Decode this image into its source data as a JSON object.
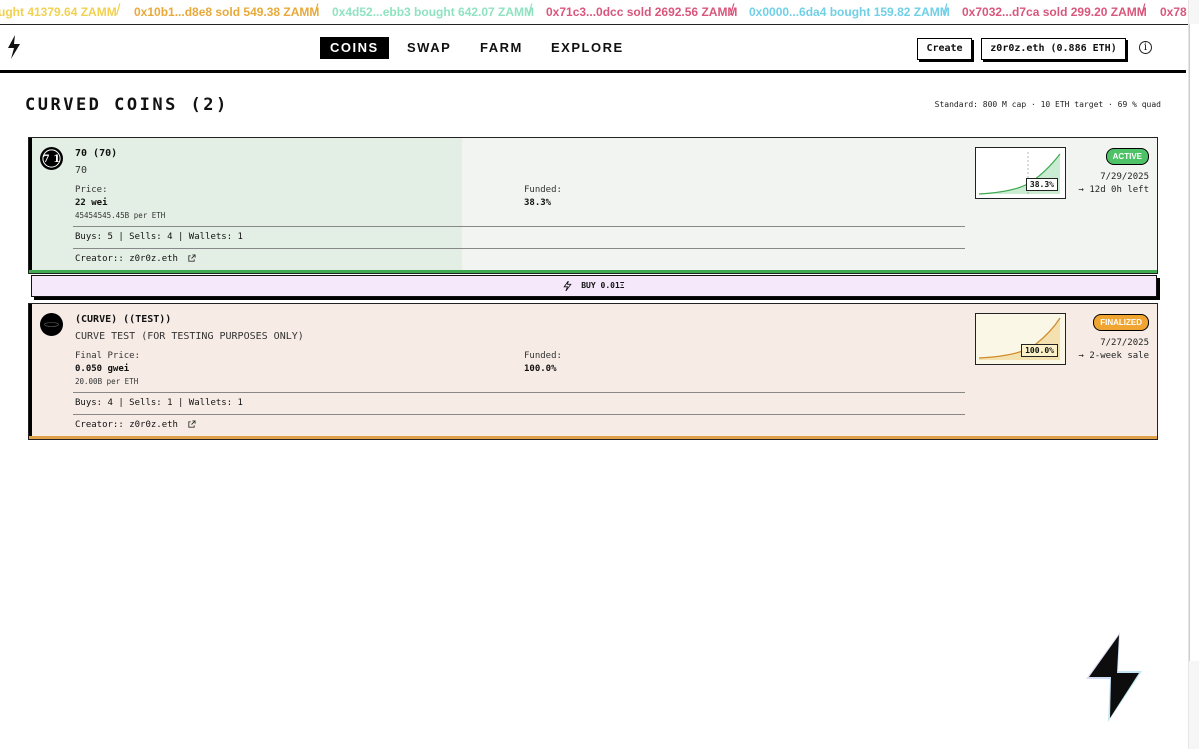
{
  "ticker": [
    {
      "text": "ught 41379.64 ZAMM",
      "color": "#f2d14e"
    },
    {
      "text": "0x10b1...d8e8 sold 549.38 ZAMM",
      "color": "#e8a93a"
    },
    {
      "text": "0x4d52...ebb3 bought 642.07 ZAMM",
      "color": "#8fe3c0"
    },
    {
      "text": "0x71c3...0dcc sold 2692.56 ZAMM",
      "color": "#d9567c"
    },
    {
      "text": "0x0000...6da4 bought 159.82 ZAMM",
      "color": "#6fd0e6"
    },
    {
      "text": "0x7032...d7ca sold 299.20 ZAMM",
      "color": "#d9567c"
    },
    {
      "text": "0x78",
      "color": "#d9567c"
    }
  ],
  "nav": {
    "coins": "COINS",
    "swap": "SWAP",
    "farm": "FARM",
    "explore": "EXPLORE"
  },
  "header": {
    "create_label": "Create",
    "account_label": "z0r0z.eth (0.886 ETH)",
    "info_glyph": "i"
  },
  "page": {
    "title": "CURVED COINS (2)",
    "standard_note": "Standard: 800 M cap · 10 ETH target · 69 % quad"
  },
  "coins": [
    {
      "name": "70 (70)",
      "description": "70",
      "avatar_text": "7 1",
      "price_label": "Price:",
      "price_value": "22 wei",
      "price_per_eth": "45454545.45B per ETH",
      "funded_label": "Funded:",
      "funded_value": "38.3%",
      "funded_fraction": 0.383,
      "stats": "Buys: 5 | Sells: 4 | Wallets: 1",
      "creator_label": "Creator::",
      "creator_value": "z0r0z.eth",
      "chart_pct": "38.3%",
      "status": "ACTIVE",
      "status_color": "#4ec267",
      "date": "7/29/2025",
      "eta": "→ 12d 0h left",
      "fill_color": "#e3efe4",
      "bg_color": "#f1f4f1",
      "accent_color": "#3fa94f"
    },
    {
      "name": "(CURVE) ((TEST))",
      "description": "CURVE TEST (FOR TESTING PURPOSES ONLY)",
      "price_label": "Final Price:",
      "price_value": "0.050 gwei",
      "price_per_eth": "20.00B per ETH",
      "funded_label": "Funded:",
      "funded_value": "100.0%",
      "funded_fraction": 1.0,
      "stats": "Buys: 4 | Sells: 1 | Wallets: 1",
      "creator_label": "Creator::",
      "creator_value": "z0r0z.eth",
      "chart_pct": "100.0%",
      "status": "FINALIZED",
      "status_color": "#f0a431",
      "date": "7/27/2025",
      "eta": "→ 2-week sale",
      "fill_color": "#f6ece5",
      "bg_color": "#f6ece5",
      "accent_color": "#e0a14a"
    }
  ],
  "buy_bar": {
    "label": "BUY 0.01Ξ"
  },
  "icons": {
    "logo": "lightning-bolt-icon",
    "info": "info-icon",
    "external": "external-link-icon",
    "bolt": "bolt-icon"
  }
}
